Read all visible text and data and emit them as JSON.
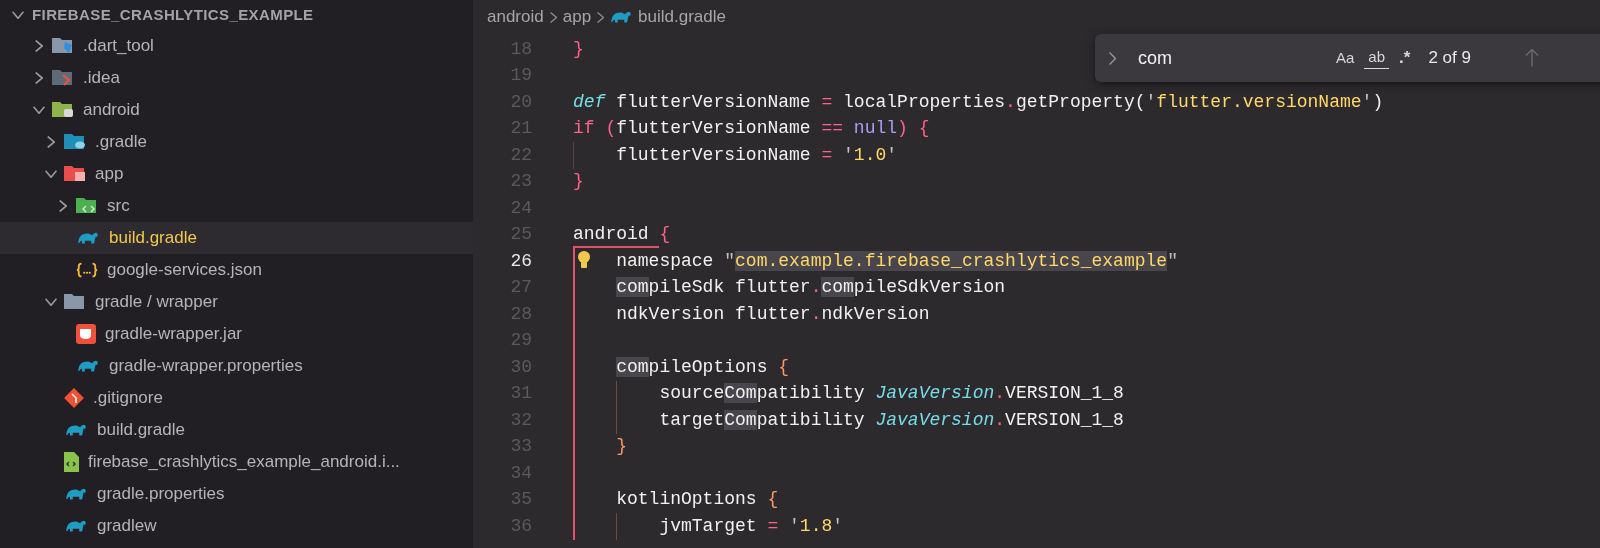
{
  "explorer": {
    "title": "FIREBASE_CRASHLYTICS_EXAMPLE",
    "expanded": true,
    "items": [
      {
        "label": ".dart_tool",
        "kind": "dart-folder",
        "expanded": false,
        "selected": false
      },
      {
        "label": ".idea",
        "kind": "idea-folder",
        "expanded": false,
        "selected": false
      },
      {
        "label": "android",
        "kind": "android-folder",
        "expanded": true,
        "selected": false,
        "children": [
          {
            "label": ".gradle",
            "kind": "gradle-folder",
            "expanded": false,
            "selected": false
          },
          {
            "label": "app",
            "kind": "app-folder",
            "expanded": true,
            "selected": false,
            "children": [
              {
                "label": "src",
                "kind": "src-folder",
                "expanded": false,
                "selected": false
              },
              {
                "label": "build.gradle",
                "kind": "gradle",
                "selected": true
              },
              {
                "label": "google-services.json",
                "kind": "json",
                "selected": false
              }
            ]
          },
          {
            "label": "gradle / wrapper",
            "kind": "folder",
            "expanded": true,
            "selected": false,
            "children": [
              {
                "label": "gradle-wrapper.jar",
                "kind": "jar",
                "selected": false
              },
              {
                "label": "gradle-wrapper.properties",
                "kind": "gradle",
                "selected": false
              }
            ]
          },
          {
            "label": ".gitignore",
            "kind": "git",
            "selected": false
          },
          {
            "label": "build.gradle",
            "kind": "gradle",
            "selected": false
          },
          {
            "label": "firebase_crashlytics_example_android.i...",
            "kind": "xml",
            "selected": false
          },
          {
            "label": "gradle.properties",
            "kind": "gradle",
            "selected": false
          },
          {
            "label": "gradlew",
            "kind": "gradle",
            "selected": false
          }
        ]
      }
    ]
  },
  "breadcrumb": [
    {
      "label": "android"
    },
    {
      "label": "app"
    },
    {
      "label": "build.gradle",
      "kind": "gradle"
    }
  ],
  "find_widget": {
    "value": "com",
    "options": [
      {
        "label": "Aa",
        "kind": "case",
        "on": false
      },
      {
        "label": "ab",
        "kind": "word",
        "on": false
      },
      {
        "label": ".*",
        "kind": "regex",
        "on": false
      }
    ],
    "result": "2 of 9"
  },
  "code_lines": [
    {
      "number": "18",
      "current": false,
      "tokens": [
        {
          "text": "}",
          "kind": "brace1"
        }
      ]
    },
    {
      "number": "19",
      "current": false
    },
    {
      "number": "20",
      "current": false,
      "tokens": [
        {
          "text": "def",
          "kind": "storage"
        },
        {
          "text": " flutterVersionName ",
          "kind": "plain"
        },
        {
          "text": "=",
          "kind": "operator"
        },
        {
          "text": " localProperties",
          "kind": "plain"
        },
        {
          "text": ".",
          "kind": "operator"
        },
        {
          "text": "getProperty(",
          "kind": "plain"
        },
        {
          "text": "'",
          "kind": "quote"
        },
        {
          "text": "flutter.versionName",
          "kind": "string"
        },
        {
          "text": "'",
          "kind": "quote"
        },
        {
          "text": ")",
          "kind": "plain"
        }
      ]
    },
    {
      "number": "21",
      "current": false,
      "active": false,
      "tokens": [
        {
          "text": "if",
          "kind": "keyword"
        },
        {
          "text": " (",
          "kind": "operator"
        },
        {
          "text": "flutterVersionName ",
          "kind": "plain"
        },
        {
          "text": "==",
          "kind": "operator"
        },
        {
          "text": " null",
          "kind": "constant"
        },
        {
          "text": ")",
          "kind": "operator"
        },
        {
          "text": " {",
          "kind": "brace1"
        }
      ],
      "children": [
        {
          "number": "22",
          "current": false,
          "tokens": [
            {
              "text": "flutterVersionName ",
              "kind": "plain"
            },
            {
              "text": "=",
              "kind": "operator"
            },
            {
              "text": " '",
              "kind": "quote"
            },
            {
              "text": "1.0",
              "kind": "string"
            },
            {
              "text": "'",
              "kind": "quote"
            }
          ]
        }
      ]
    },
    {
      "number": "23",
      "current": false,
      "tokens": [
        {
          "text": "}",
          "kind": "brace1"
        }
      ]
    },
    {
      "number": "24",
      "current": false
    },
    {
      "number": "25",
      "current": false,
      "active": true,
      "tokens": [
        {
          "text": "android ",
          "kind": "plain"
        },
        {
          "text": "{",
          "kind": "brace1"
        }
      ],
      "children": [
        {
          "number": "26",
          "current": true,
          "lightbulb": true,
          "tokens": [
            {
              "text": "namespace ",
              "kind": "plain"
            },
            {
              "text": "\"",
              "kind": "quote"
            },
            {
              "text": "com.example.firebase_crashlytics_example",
              "kind": "string",
              "match": true
            },
            {
              "text": "\"",
              "kind": "quote"
            }
          ]
        },
        {
          "number": "27",
          "current": false,
          "tokens": [
            {
              "text": "com",
              "kind": "plain",
              "match": true
            },
            {
              "text": "pileSdk flutter",
              "kind": "plain"
            },
            {
              "text": ".",
              "kind": "operator"
            },
            {
              "text": "com",
              "kind": "plain",
              "match": true
            },
            {
              "text": "pileSdkVersion",
              "kind": "plain"
            }
          ]
        },
        {
          "number": "28",
          "current": false,
          "tokens": [
            {
              "text": "ndkVersion flutter",
              "kind": "plain"
            },
            {
              "text": ".",
              "kind": "operator"
            },
            {
              "text": "ndkVersion",
              "kind": "plain"
            }
          ]
        },
        {
          "number": "29",
          "current": false
        },
        {
          "number": "30",
          "current": false,
          "active": false,
          "tokens": [
            {
              "text": "com",
              "kind": "plain",
              "match": true
            },
            {
              "text": "pileOptions ",
              "kind": "plain"
            },
            {
              "text": "{",
              "kind": "brace2"
            }
          ],
          "children": [
            {
              "number": "31",
              "current": false,
              "tokens": [
                {
                  "text": "source",
                  "kind": "plain"
                },
                {
                  "text": "Com",
                  "kind": "plain",
                  "match": true
                },
                {
                  "text": "patibility ",
                  "kind": "plain"
                },
                {
                  "text": "JavaVersion",
                  "kind": "type"
                },
                {
                  "text": ".",
                  "kind": "operator"
                },
                {
                  "text": "VERSION_1_8",
                  "kind": "plain"
                }
              ]
            },
            {
              "number": "32",
              "current": false,
              "tokens": [
                {
                  "text": "target",
                  "kind": "plain"
                },
                {
                  "text": "Com",
                  "kind": "plain",
                  "match": true
                },
                {
                  "text": "patibility ",
                  "kind": "plain"
                },
                {
                  "text": "JavaVersion",
                  "kind": "type"
                },
                {
                  "text": ".",
                  "kind": "operator"
                },
                {
                  "text": "VERSION_1_8",
                  "kind": "plain"
                }
              ]
            }
          ]
        },
        {
          "number": "33",
          "current": false,
          "tokens": [
            {
              "text": "}",
              "kind": "brace2"
            }
          ]
        },
        {
          "number": "34",
          "current": false
        },
        {
          "number": "35",
          "current": false,
          "active": false,
          "tokens": [
            {
              "text": "kotlinOptions ",
              "kind": "plain"
            },
            {
              "text": "{",
              "kind": "brace2"
            }
          ],
          "children": [
            {
              "number": "36",
              "current": false,
              "tokens": [
                {
                  "text": "jvmTarget ",
                  "kind": "plain"
                },
                {
                  "text": "=",
                  "kind": "operator"
                },
                {
                  "text": " '",
                  "kind": "quote"
                },
                {
                  "text": "1.8",
                  "kind": "string"
                },
                {
                  "text": "'",
                  "kind": "quote"
                }
              ]
            }
          ]
        }
      ]
    }
  ]
}
